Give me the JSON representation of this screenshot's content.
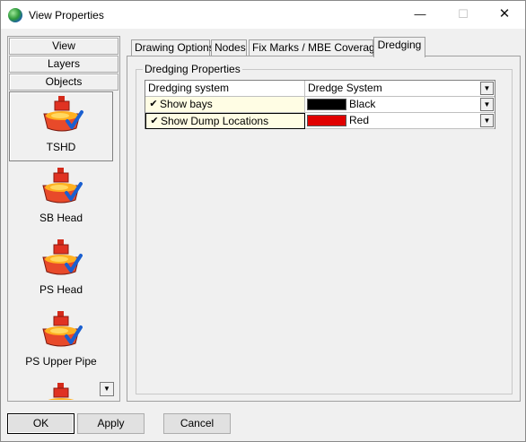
{
  "window": {
    "title": "View Properties"
  },
  "nav": {
    "view": "View",
    "layers": "Layers",
    "objects": "Objects"
  },
  "objects": [
    {
      "label": "TSHD",
      "selected": true,
      "icon": "tshd-vessel-icon"
    },
    {
      "label": "SB Head",
      "selected": false,
      "icon": "tshd-vessel-icon"
    },
    {
      "label": "PS Head",
      "selected": false,
      "icon": "tshd-vessel-icon"
    },
    {
      "label": "PS Upper Pipe",
      "selected": false,
      "icon": "tshd-vessel-icon"
    }
  ],
  "tabs": [
    "Drawing Options",
    "Nodes",
    "Fix Marks / MBE Coverage",
    "Dredging"
  ],
  "active_tab": "Dredging",
  "group": {
    "title": "Dredging Properties"
  },
  "grid": {
    "header": {
      "name": "Dredging system",
      "value": "Dredge System"
    },
    "rows": [
      {
        "name": "Show bays",
        "checked": true,
        "color_name": "Black",
        "color": "#000000"
      },
      {
        "name": "Show Dump Locations",
        "checked": true,
        "color_name": "Red",
        "color": "#e00000"
      }
    ]
  },
  "buttons": {
    "ok": "OK",
    "apply": "Apply",
    "cancel": "Cancel"
  },
  "glyphs": {
    "check": "✔",
    "dropdown": "▼",
    "minimize": "—",
    "maximize": "☐",
    "close": "✕"
  }
}
